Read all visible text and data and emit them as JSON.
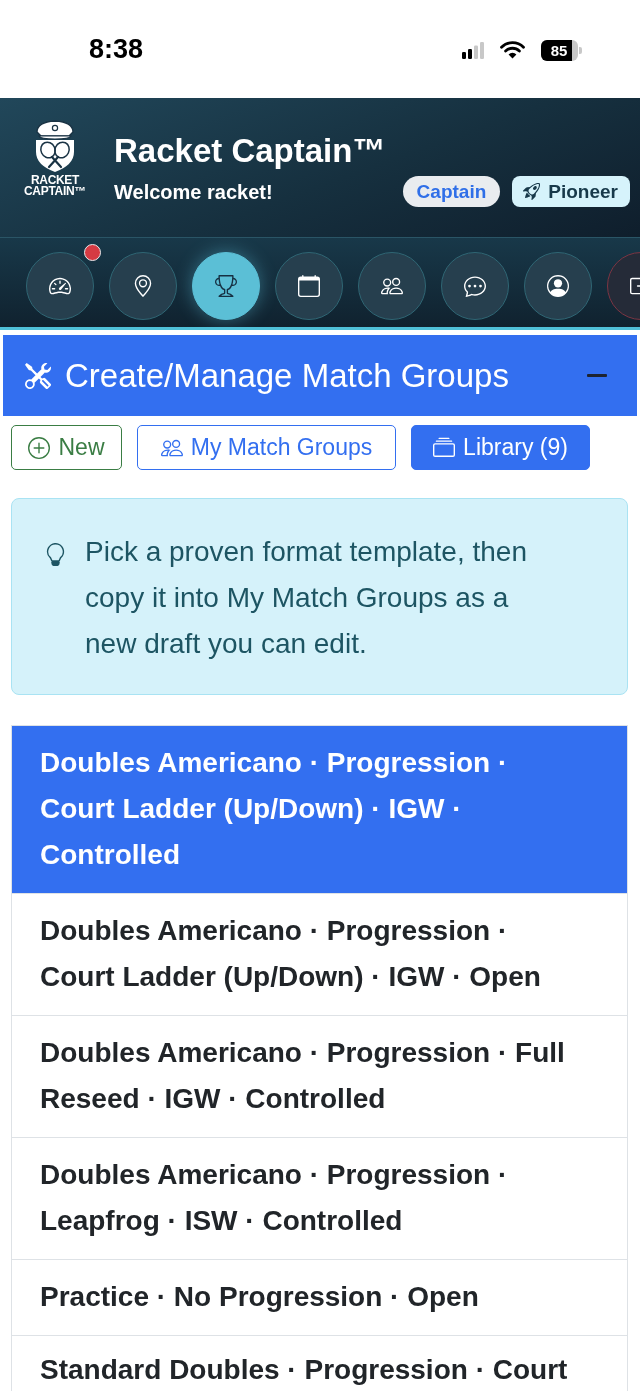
{
  "status_bar": {
    "time": "8:38",
    "battery": "85"
  },
  "header": {
    "logo_lines": [
      "RACKET",
      "CAPTAIN™"
    ],
    "title": "Racket Captain™",
    "welcome": "Welcome racket!",
    "badges": [
      {
        "label": "Captain",
        "kind": "role"
      },
      {
        "label": "Pioneer",
        "kind": "award"
      }
    ]
  },
  "nav": [
    {
      "selected": false,
      "alert": true,
      "kind": "normal"
    },
    {
      "selected": false,
      "alert": false,
      "kind": "normal"
    },
    {
      "selected": true,
      "alert": false,
      "kind": "normal"
    },
    {
      "selected": false,
      "alert": false,
      "kind": "normal"
    },
    {
      "selected": false,
      "alert": false,
      "kind": "normal"
    },
    {
      "selected": false,
      "alert": false,
      "kind": "normal"
    },
    {
      "selected": false,
      "alert": false,
      "kind": "normal"
    },
    {
      "selected": false,
      "alert": false,
      "kind": "danger"
    }
  ],
  "panel": {
    "title": "Create/Manage Match Groups",
    "expanded": true
  },
  "buttons": [
    {
      "label": "New",
      "color": "#3a7d44",
      "selected": false
    },
    {
      "label": "My Match Groups",
      "color": "#336ff0",
      "selected": false
    },
    {
      "label": "Library (9)",
      "color": "#336ff0",
      "selected": true
    }
  ],
  "info": "Pick a proven format template, then copy it into My Match Groups as a new draft you can edit.",
  "templates": [
    {
      "label": "Doubles Americano · Progression · Court Ladder (Up/Down) · IGW · Controlled",
      "selected": true
    },
    {
      "label": "Doubles Americano · Progression · Court Ladder (Up/Down) · IGW · Open",
      "selected": false
    },
    {
      "label": "Doubles Americano · Progression · Full Reseed · IGW · Controlled",
      "selected": false
    },
    {
      "label": "Doubles Americano · Progression · Leapfrog · ISW · Controlled",
      "selected": false
    },
    {
      "label": "Practice · No Progression · Open",
      "selected": false
    },
    {
      "label": "Standard Doubles · Progression · Court",
      "selected": false
    }
  ]
}
